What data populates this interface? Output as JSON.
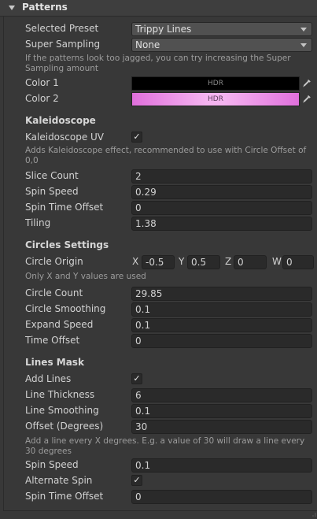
{
  "header": {
    "title": "Patterns"
  },
  "preset": {
    "label": "Selected Preset",
    "value": "Trippy Lines"
  },
  "super_sampling": {
    "label": "Super Sampling",
    "value": "None",
    "help": "If the patterns look too jagged, you can try increasing the Super Sampling amount"
  },
  "color1": {
    "label": "Color 1",
    "tag": "HDR",
    "color": "#000000"
  },
  "color2": {
    "label": "Color 2",
    "tag": "HDR",
    "color": "#e36ee1"
  },
  "kaleidoscope": {
    "title": "Kaleidoscope",
    "uv_label": "Kaleidoscope UV",
    "uv_checked": "✓",
    "help": "Adds Kaleidoscope effect, recommended to use with Circle Offset of 0,0",
    "slice_count": {
      "label": "Slice Count",
      "value": "2"
    },
    "spin_speed": {
      "label": "Spin Speed",
      "value": "0.29"
    },
    "spin_time_offset": {
      "label": "Spin Time Offset",
      "value": "0"
    },
    "tiling": {
      "label": "Tiling",
      "value": "1.38"
    }
  },
  "circles": {
    "title": "Circles Settings",
    "origin": {
      "label": "Circle Origin",
      "x_label": "X",
      "x": "-0.5",
      "y_label": "Y",
      "y": "0.5",
      "z_label": "Z",
      "z": "0",
      "w_label": "W",
      "w": "0"
    },
    "origin_help": "Only X and Y values are used",
    "count": {
      "label": "Circle Count",
      "value": "29.85"
    },
    "smoothing": {
      "label": "Circle Smoothing",
      "value": "0.1"
    },
    "expand_speed": {
      "label": "Expand Speed",
      "value": "0.1"
    },
    "time_offset": {
      "label": "Time Offset",
      "value": "0"
    }
  },
  "lines": {
    "title": "Lines Mask",
    "add_label": "Add Lines",
    "add_checked": "✓",
    "thickness": {
      "label": "Line Thickness",
      "value": "6"
    },
    "smoothing": {
      "label": "Line Smoothing",
      "value": "0.1"
    },
    "offset": {
      "label": "Offset (Degrees)",
      "value": "30"
    },
    "offset_help": "Add a line every X degrees. E.g. a value of 30 will draw a line every 30 degrees",
    "spin_speed": {
      "label": "Spin Speed",
      "value": "0.1"
    },
    "alternate_label": "Alternate Spin",
    "alternate_checked": "✓",
    "spin_time_offset": {
      "label": "Spin Time Offset",
      "value": "0"
    }
  },
  "icons": {
    "foldout": "triangle-down",
    "dropdown": "triangle-down",
    "picker": "eyedropper",
    "toggle": "checkmark"
  }
}
